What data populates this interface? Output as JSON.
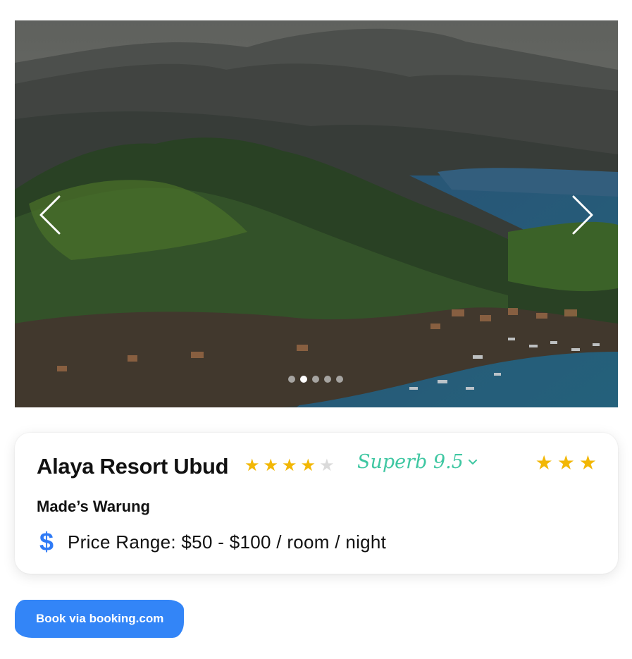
{
  "hero": {
    "image_description_icon": "landscape-photo",
    "prev_icon": "chevron-left-icon",
    "next_icon": "chevron-right-icon",
    "slide_count": 5,
    "active_slide": 2
  },
  "hotel": {
    "name": "Alaya Resort Ubud",
    "user_rating_stars": 4,
    "user_rating_max": 5,
    "rating_label": "Superb 9.5",
    "class_stars": 3,
    "restaurant": "Made’s Warung",
    "currency_symbol": "$",
    "price_range": "Price Range: $50 - $100 / room / night"
  },
  "actions": {
    "book_label": "Book via booking.com"
  },
  "colors": {
    "accent_blue": "#3385f7",
    "star_gold": "#f2b705",
    "rating_teal": "#3fc7a2"
  }
}
